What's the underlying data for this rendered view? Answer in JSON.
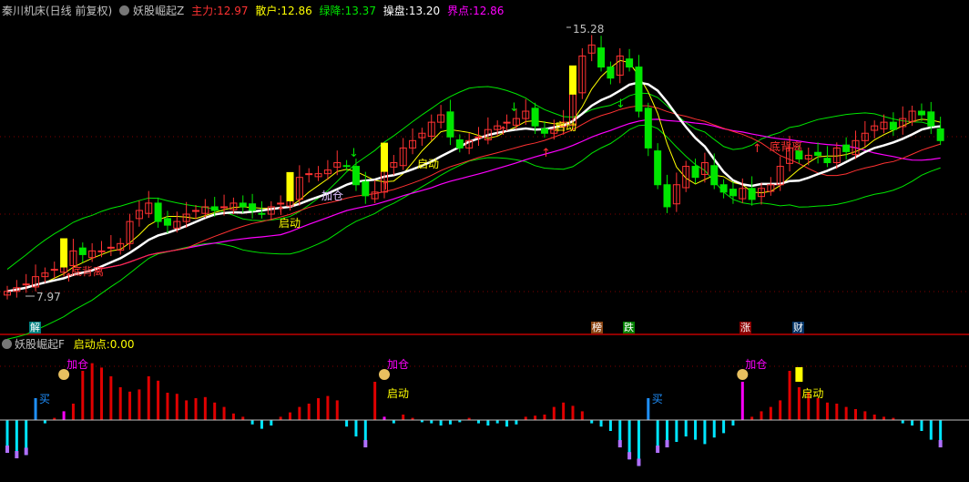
{
  "header": {
    "stock": "秦川机床(日线 前复权)",
    "indicator": "妖股崛起Z",
    "zhuli_label": "主力:",
    "zhuli": "12.97",
    "sanhu_label": "散户:",
    "sanhu": "12.86",
    "lvjiang_label": "绿降:",
    "lvjiang": "13.37",
    "caopan_label": "操盘:",
    "caopan": "13.20",
    "jiedian_label": "界点:",
    "jiedian": "12.86"
  },
  "sub_header": {
    "indicator": "妖股崛起F",
    "qidong_label": "启动点:",
    "qidong": "0.00"
  },
  "colors": {
    "up": "#ff3232",
    "down": "#00e600",
    "white": "#ffffff",
    "yellow": "#ffff00",
    "magenta": "#ff00ff",
    "cyan": "#00e5ff",
    "panel_sep": "#c00000"
  },
  "annotations": {
    "high": "15.28",
    "low": "7.97",
    "qidong": "启动",
    "jiacang": "加仓",
    "mai": "买",
    "beili": "底背离"
  },
  "markers": [
    {
      "text": "解",
      "color": "#008080"
    },
    {
      "text": "榜",
      "color": "#8b4513"
    },
    {
      "text": "跌",
      "color": "#008000"
    },
    {
      "text": "涨",
      "color": "#8b0000"
    },
    {
      "text": "财",
      "color": "#003366"
    }
  ],
  "chart_data": [
    {
      "type": "candlestick",
      "title": "妖股崛起Z",
      "ylim": [
        7.5,
        15.8
      ],
      "close": [
        8.1,
        8.2,
        8.3,
        8.5,
        8.6,
        8.7,
        8.8,
        9.2,
        9.1,
        9.2,
        9.2,
        9.3,
        9.4,
        10.0,
        10.3,
        10.5,
        10.0,
        9.9,
        10.0,
        10.2,
        10.3,
        10.4,
        10.3,
        10.4,
        10.5,
        10.4,
        10.3,
        10.2,
        10.4,
        10.5,
        10.6,
        11.2,
        11.3,
        11.3,
        11.4,
        11.6,
        11.5,
        11.0,
        10.7,
        10.8,
        11.4,
        11.6,
        12.0,
        12.2,
        12.4,
        12.7,
        12.9,
        12.3,
        12.0,
        12.2,
        12.3,
        12.5,
        12.6,
        12.7,
        12.8,
        13.0,
        12.6,
        12.4,
        12.5,
        12.7,
        13.5,
        14.5,
        14.8,
        14.2,
        13.9,
        14.5,
        14.2,
        13.0,
        12.0,
        11.0,
        10.4,
        11.0,
        11.5,
        11.2,
        11.6,
        11.0,
        10.8,
        10.7,
        10.9,
        10.6,
        10.9,
        11.0,
        11.5,
        12.0,
        11.7,
        11.8,
        11.8,
        11.6,
        12.0,
        11.9,
        12.2,
        12.4,
        12.6,
        12.7,
        12.5,
        12.8,
        13.0,
        12.9,
        12.6,
        12.2
      ]
    },
    {
      "type": "bar",
      "title": "妖股崛起F",
      "ylim": [
        -5.5,
        5.5
      ],
      "values": [
        -3,
        -3.5,
        -3.2,
        2,
        -0.3,
        0.2,
        0.8,
        1.5,
        4.5,
        5.2,
        4.8,
        4,
        3,
        2.6,
        2.8,
        4,
        3.6,
        2.5,
        2.4,
        1.8,
        2,
        2.1,
        1.6,
        1.2,
        0.6,
        0.3,
        -0.4,
        -0.8,
        -0.5,
        0.3,
        0.7,
        1.2,
        1.5,
        2,
        2.2,
        1.8,
        -0.6,
        -1.5,
        -2.5,
        3.5,
        0.3,
        -0.3,
        0.5,
        0.2,
        -0.2,
        -0.3,
        -0.5,
        -0.4,
        -0.2,
        0.2,
        -0.3,
        -0.5,
        -0.3,
        -0.6,
        -0.4,
        0.3,
        0.4,
        0.5,
        1.2,
        1.6,
        1.3,
        0.8,
        -0.3,
        -0.6,
        -1,
        -2.5,
        -3.6,
        -4.2,
        2,
        -3,
        -2.5,
        -2,
        -1.5,
        -1.8,
        -2.2,
        -1.6,
        -1.2,
        -0.5,
        3.5,
        0.3,
        0.8,
        1.2,
        1.8,
        4.5,
        3,
        2.5,
        2,
        1.6,
        1.5,
        1.2,
        1,
        0.8,
        0.5,
        0.3,
        0.2,
        -0.3,
        -0.5,
        -1,
        -1.8,
        -2.5
      ]
    }
  ]
}
